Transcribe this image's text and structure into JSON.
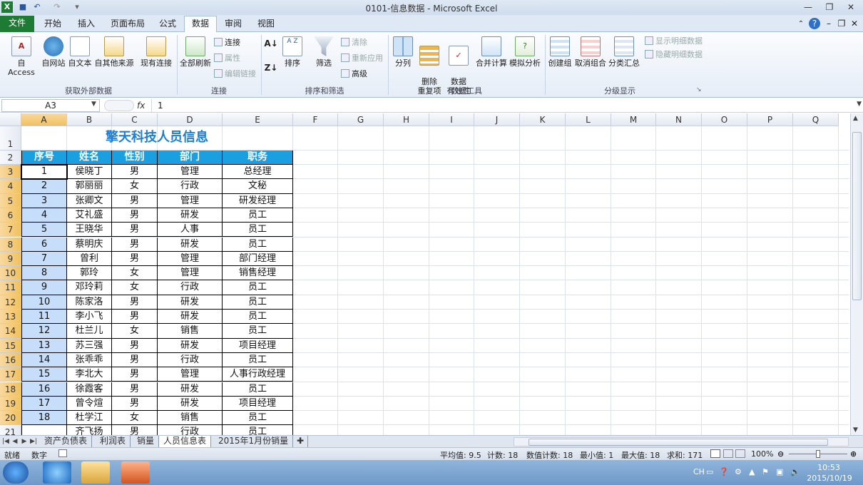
{
  "window": {
    "title": "0101-信息数据 - Microsoft Excel"
  },
  "menu_tabs": [
    {
      "label": "文件"
    },
    {
      "label": "开始"
    },
    {
      "label": "插入"
    },
    {
      "label": "页面布局"
    },
    {
      "label": "公式"
    },
    {
      "label": "数据"
    },
    {
      "label": "审阅"
    },
    {
      "label": "视图"
    }
  ],
  "active_tab": "数据",
  "ribbon": {
    "groups": [
      {
        "label": "获取外部数据",
        "buttons": [
          "自 Access",
          "自网站",
          "自文本",
          "自其他来源",
          "现有连接"
        ]
      },
      {
        "label": "连接",
        "buttons": [
          "全部刷新"
        ],
        "small": [
          "连接",
          "属性",
          "编辑链接"
        ]
      },
      {
        "label": "排序和筛选",
        "buttons": [
          "排序",
          "筛选"
        ],
        "small": [
          "清除",
          "重新应用",
          "高级"
        ]
      },
      {
        "label": "数据工具",
        "buttons": [
          "分列",
          "删除\n重复项",
          "数据\n有效性",
          "合并计算",
          "模拟分析"
        ]
      },
      {
        "label": "分级显示",
        "buttons": [
          "创建组",
          "取消组合",
          "分类汇总"
        ],
        "small": [
          "显示明细数据",
          "隐藏明细数据"
        ]
      }
    ]
  },
  "formula_bar": {
    "name_box": "A3",
    "fx": "fx",
    "value": "1"
  },
  "columns": [
    "A",
    "B",
    "C",
    "D",
    "E",
    "F",
    "G",
    "H",
    "I",
    "J",
    "K",
    "L",
    "M",
    "N",
    "O",
    "P",
    "Q"
  ],
  "sheet": {
    "title": "擎天科技人员信息",
    "headers": [
      "序号",
      "姓名",
      "性别",
      "部门",
      "职务"
    ],
    "rows": [
      [
        "1",
        "侯晓丁",
        "男",
        "管理",
        "总经理"
      ],
      [
        "2",
        "郭丽丽",
        "女",
        "行政",
        "文秘"
      ],
      [
        "3",
        "张卿文",
        "男",
        "管理",
        "研发经理"
      ],
      [
        "4",
        "艾礼盛",
        "男",
        "研发",
        "员工"
      ],
      [
        "5",
        "王晓华",
        "男",
        "人事",
        "员工"
      ],
      [
        "6",
        "蔡明庆",
        "男",
        "研发",
        "员工"
      ],
      [
        "7",
        "曾利",
        "男",
        "管理",
        "部门经理"
      ],
      [
        "8",
        "郭玲",
        "女",
        "管理",
        "销售经理"
      ],
      [
        "9",
        "邓玲莉",
        "女",
        "行政",
        "员工"
      ],
      [
        "10",
        "陈家洛",
        "男",
        "研发",
        "员工"
      ],
      [
        "11",
        "李小飞",
        "男",
        "研发",
        "员工"
      ],
      [
        "12",
        "杜兰儿",
        "女",
        "销售",
        "员工"
      ],
      [
        "13",
        "苏三强",
        "男",
        "研发",
        "项目经理"
      ],
      [
        "14",
        "张乖乖",
        "男",
        "行政",
        "员工"
      ],
      [
        "15",
        "李北大",
        "男",
        "管理",
        "人事行政经理"
      ],
      [
        "16",
        "徐霞客",
        "男",
        "研发",
        "员工"
      ],
      [
        "17",
        "曾令煊",
        "男",
        "研发",
        "项目经理"
      ],
      [
        "18",
        "杜学江",
        "女",
        "销售",
        "员工"
      ],
      [
        "",
        "齐飞扬",
        "男",
        "行政",
        "员工"
      ]
    ],
    "row_numbers": [
      "1",
      "2",
      "3",
      "4",
      "5",
      "6",
      "7",
      "8",
      "9",
      "10",
      "11",
      "12",
      "13",
      "14",
      "15",
      "16",
      "17",
      "18",
      "19",
      "20",
      "21"
    ]
  },
  "sheet_tabs": [
    "资产负债表",
    "利润表",
    "销量",
    "人员信息表",
    "2015年1月份销量"
  ],
  "active_sheet": "人员信息表",
  "status": {
    "mode": "就绪",
    "num": "数字",
    "average": "平均值: 9.5",
    "count": "计数: 18",
    "numeric_count": "数值计数: 18",
    "min": "最小值: 1",
    "max": "最大值: 18",
    "sum": "求和: 171",
    "zoom": "100%"
  },
  "taskbar": {
    "lang": "CH",
    "time": "10:53",
    "date": "2015/10/19"
  },
  "colors": {
    "header_fill": "#1aa0e0",
    "title_text": "#1d7fd4",
    "file_tab": "#1e7b34",
    "selection": "#c6defa"
  }
}
